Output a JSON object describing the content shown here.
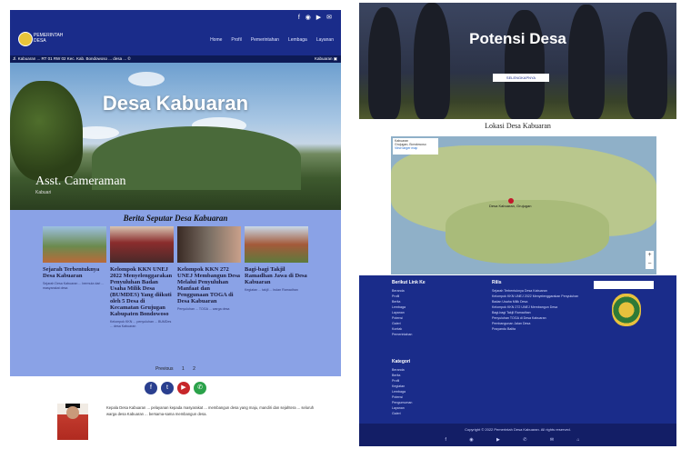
{
  "left_page": {
    "header": {
      "brand_line1": "PEMERINTAH",
      "brand_line2": "DESA",
      "nav": [
        "Home",
        "Profil",
        "Pemerintahan",
        "Lembaga",
        "Layanan"
      ],
      "top_icons": "f ◉ ▶ ✉"
    },
    "ticker": {
      "left": "Jl. Kabuaran ... RT 01 RW 02 Kec. Kab. Bondowoso ... desa ... ©",
      "right": "Kabuaran ▣"
    },
    "hero": {
      "title": "Desa Kabuaran",
      "caption": "Asst. Cameraman",
      "caption_sub": "Kabuari"
    },
    "news": {
      "heading": "Berita Seputar Desa Kabuaran",
      "cards": [
        {
          "title": "Sejarah Terbentuknya Desa Kabuaran",
          "excerpt": "Sejarah Desa Kabuaran ... bermula dari ... masyarakat desa",
          "img1": "#6b8a4e",
          "img2": "#b96a3a"
        },
        {
          "title": "Kelompok KKN UNEJ 2022 Menyelenggarakan Penyuluhan Badan Usaha Milik Desa (BUMDES) Yang diikuti oleh 5 Desa di Kecamatan Grujugan Kabupaten Bondowoso",
          "excerpt": "Kelompok KKN ... penyuluhan ... BUMDes ... desa Kabuaran",
          "img1": "#8a2c2c",
          "img2": "#d8c5b2"
        },
        {
          "title": "Kelompok KKN 272 UNEJ Membangun Desa Melalui Penyuluhan Manfaat dan Penggunaan TOGA di Desa Kabuaran",
          "excerpt": "Penyuluhan ... TOGA ... warga desa",
          "img1": "#3a2a24",
          "img2": "#7a6f64"
        },
        {
          "title": "Bagi-bagi Takjil Ramadhan Jawa di Desa Kabuaran",
          "excerpt": "Kegiatan ... takjil ... bulan Ramadhan",
          "img1": "#a45a3a",
          "img2": "#5d7a3c"
        }
      ],
      "pager_prev": "Previous",
      "pager_page": "1",
      "pager_next": "2"
    },
    "social": [
      {
        "icon": "facebook-icon",
        "glyph": "f",
        "color": "#2a3f8f"
      },
      {
        "icon": "twitter-icon",
        "glyph": "t",
        "color": "#2a3f8f"
      },
      {
        "icon": "youtube-icon",
        "glyph": "▶",
        "color": "#c7262a"
      },
      {
        "icon": "whatsapp-icon",
        "glyph": "✆",
        "color": "#2ba24a"
      }
    ],
    "bio": "Kepala Desa Kabuaran ... pelayanan kepada masyarakat ... membangun desa yang maju, mandiri dan sejahtera ... seluruh warga desa Kabuaran ... bersama-sama membangun desa."
  },
  "right_page": {
    "hero": {
      "title": "Potensi Desa",
      "button": "SELENGKAPNYA"
    },
    "location_title": "Lokasi Desa Kabuaran",
    "map": {
      "info_line1": "Kabuaran",
      "info_line2": "Grujugan, Bondowoso",
      "info_link": "View larger map",
      "pin_label": "Desa Kabuaran, Grujugan",
      "zoom_in": "+",
      "zoom_out": "−"
    },
    "footer": {
      "col1_title": "Berikut Link Ke",
      "col1_items": [
        "Beranda",
        "Profil",
        "Berita",
        "Lembaga",
        "Layanan",
        "Potensi",
        "Galeri",
        "Kontak",
        "Pemerintahan"
      ],
      "col2_title": "Rilis",
      "col2_items": [
        "Sejarah Terbentuknya Desa Kabuaran",
        "Kelompok KKN UNEJ 2022 Menyelenggarakan Penyuluhan Badan Usaha Milik Desa",
        "Kelompok KKN 272 UNEJ Membangun Desa",
        "Bagi-bagi Takjil Ramadhan",
        "Penyuluhan TOGA di Desa Kabuaran",
        "Pembangunan Jalan Desa",
        "Posyandu Balita"
      ],
      "col3_title": "Kategori",
      "col3_items": [
        "Beranda",
        "Berita",
        "Profil",
        "Kegiatan",
        "Lembaga",
        "Potensi",
        "Pengumuman",
        "Layanan",
        "Galeri"
      ]
    },
    "copyright": "Copyright © 2022 Pemerintah Desa Kabuaran. All rights reserved.",
    "copy_icons": "f ◉ ▶ ✆ ✉ ⌂"
  }
}
